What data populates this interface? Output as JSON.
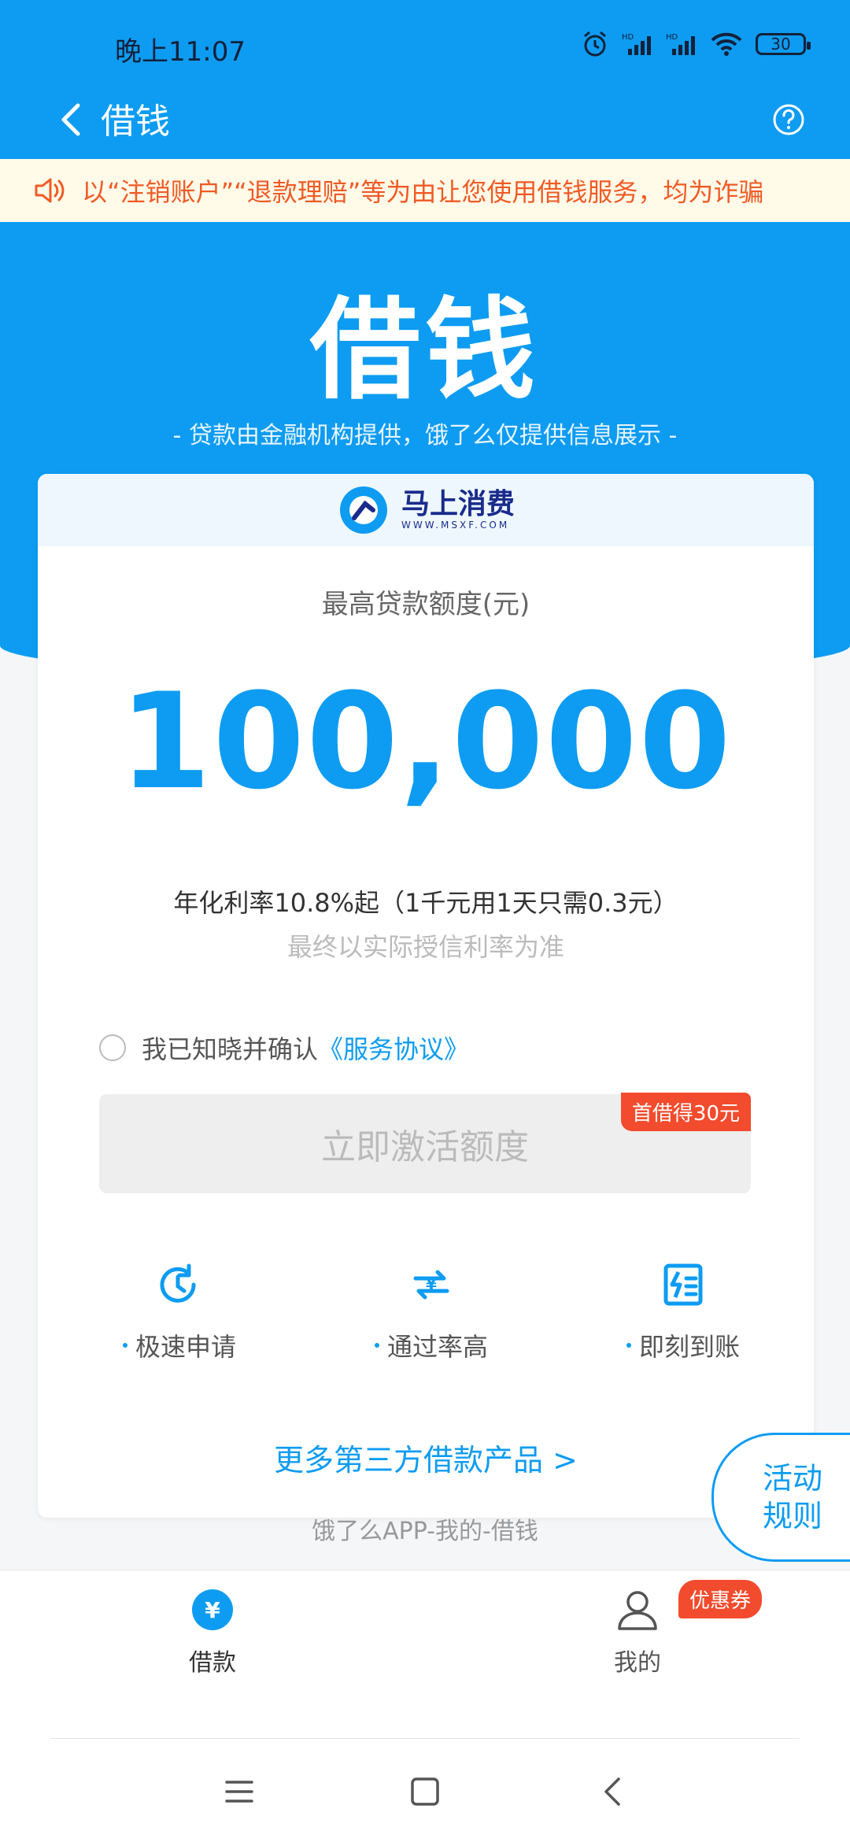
{
  "status_bar": {
    "time": "晚上11:07",
    "battery": "30"
  },
  "header": {
    "title": "借钱"
  },
  "notice": {
    "text": "以“注销账户”“退款理赔”等为由让您使用借钱服务，均为诈骗"
  },
  "hero": {
    "title": "借钱",
    "subtitle": "- 贷款由金融机构提供，饿了么仅提供信息展示 -"
  },
  "card": {
    "logo_name": "马上消费",
    "logo_url": "WWW.MSXF.COM",
    "limit_label": "最高贷款额度(元)",
    "amount": "100,000",
    "rate": "年化利率10.8%起（1千元用1天只需0.3元）",
    "rate_note": "最终以实际授信利率为准",
    "agree_text": "我已知晓并确认",
    "agree_link": "《服务协议》",
    "activate_button": "立即激活额度",
    "promo_badge": "首借得30元",
    "features": [
      {
        "label": "极速申请",
        "icon": "clock-refresh-icon"
      },
      {
        "label": "通过率高",
        "icon": "yuan-exchange-icon"
      },
      {
        "label": "即刻到账",
        "icon": "lightning-document-icon"
      }
    ],
    "more_link": "更多第三方借款产品 >"
  },
  "faint_text": "饿了么APP-我的-借钱",
  "activity_button": {
    "line1": "活动",
    "line2": "规则"
  },
  "tabbar": {
    "items": [
      {
        "label": "借款",
        "icon": "yuan-circle-icon",
        "active": true
      },
      {
        "label": "我的",
        "icon": "person-icon",
        "active": false
      }
    ],
    "coupon_badge": "优惠券"
  },
  "colors": {
    "primary": "#0d9cf2",
    "warning": "#f05a26",
    "badge": "#f24b2d"
  }
}
